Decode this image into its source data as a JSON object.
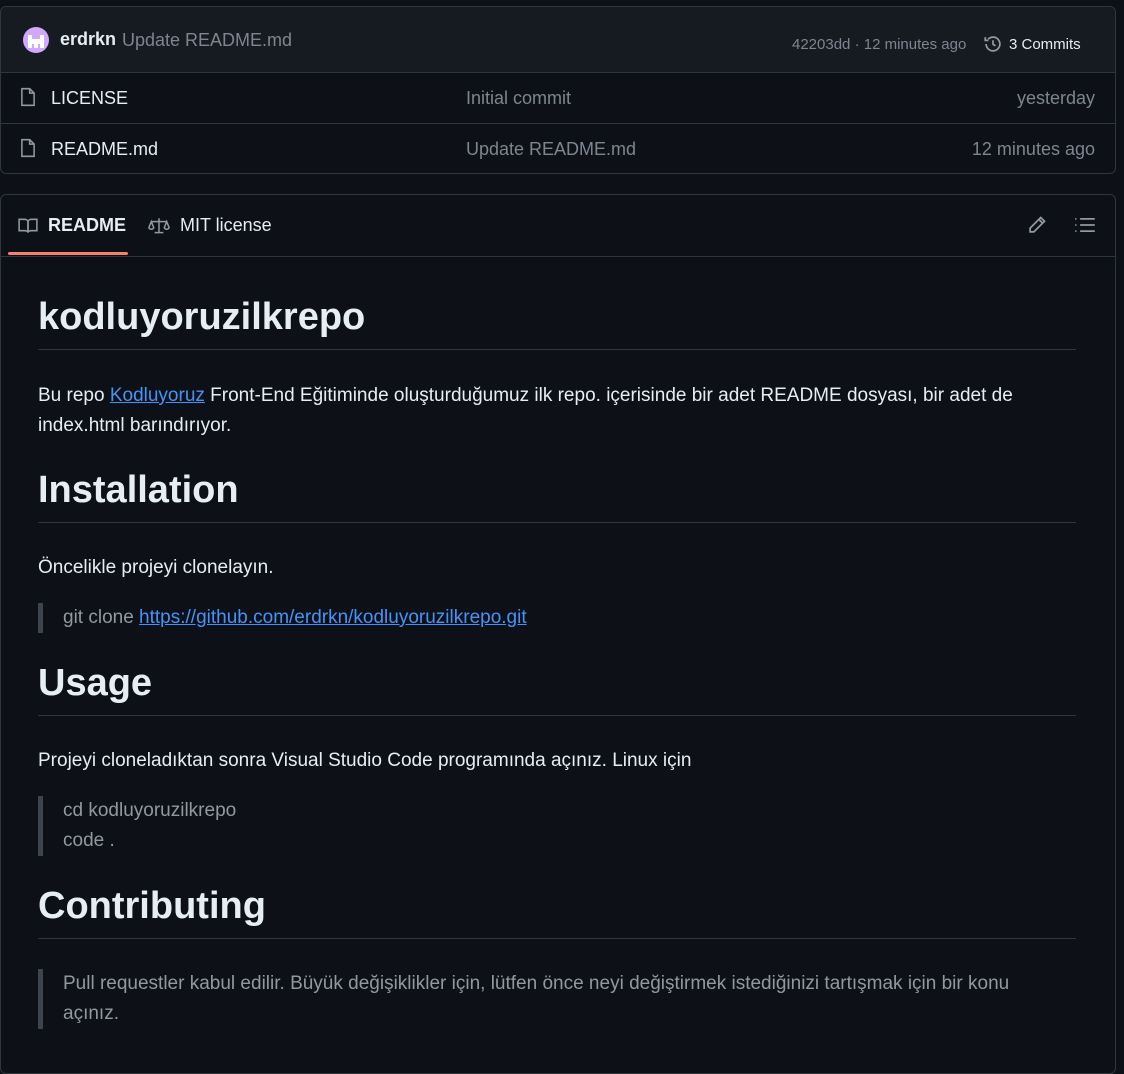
{
  "commit": {
    "author": "erdrkn",
    "message": "Update README.md",
    "meta": "42203dd · 12 minutes ago",
    "commits_label": "3 Commits"
  },
  "files": [
    {
      "name": "LICENSE",
      "commit": "Initial commit",
      "date": "yesterday"
    },
    {
      "name": "README.md",
      "commit": "Update README.md",
      "date": "12 minutes ago"
    }
  ],
  "tabs": {
    "readme": "README",
    "license": "MIT license"
  },
  "readme": {
    "title": "kodluyoruzilkrepo",
    "intro_before_link": "Bu repo ",
    "intro_link": "Kodluyoruz",
    "intro_after_link": " Front-End Eğitiminde oluşturduğumuz ilk repo. içerisinde bir adet README dosyası, bir adet de index.html barındırıyor.",
    "installation_heading": "Installation",
    "installation_text": "Öncelikle projeyi clonelayın.",
    "clone_prefix": "git clone ",
    "clone_url": "https://github.com/erdrkn/kodluyoruzilkrepo.git",
    "usage_heading": "Usage",
    "usage_text": "Projeyi cloneladıktan sonra Visual Studio Code programında açınız. Linux için",
    "usage_cmd_1": "cd kodluyoruzilkrepo",
    "usage_cmd_2": "code .",
    "contributing_heading": "Contributing",
    "contributing_text": "Pull requestler kabul edilir. Büyük değişiklikler için, lütfen önce neyi değiştirmek istediğinizi tartışmak için bir konu açınız."
  },
  "colors": {
    "background": "#0d1117",
    "border": "#30363d",
    "link": "#4493f8",
    "tab_underline": "#f78166",
    "muted": "#7d8590"
  }
}
